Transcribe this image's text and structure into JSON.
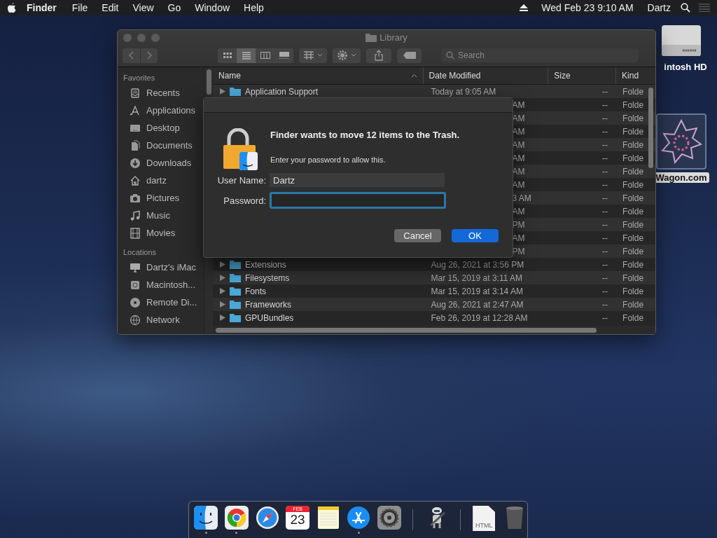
{
  "menu_bar": {
    "app_name": "Finder",
    "menus": [
      "File",
      "Edit",
      "View",
      "Go",
      "Window",
      "Help"
    ],
    "clock": "Wed Feb 23  9:10 AM",
    "user": "Dartz"
  },
  "desktop_icons": [
    {
      "kind": "drive",
      "label": "intosh HD",
      "selected": false
    },
    {
      "kind": "image",
      "label": "Wagon.com",
      "selected": true
    }
  ],
  "finder": {
    "title": "Library",
    "view_modes": [
      {
        "kind": "icons",
        "selected": false
      },
      {
        "kind": "list",
        "selected": true
      },
      {
        "kind": "columns",
        "selected": false
      },
      {
        "kind": "gallery",
        "selected": false
      }
    ],
    "search": {
      "placeholder": "Search"
    },
    "sidebar": [
      {
        "heading": "Favorites",
        "items": [
          {
            "kind": "recents",
            "label": "Recents"
          },
          {
            "kind": "applications",
            "label": "Applications"
          },
          {
            "kind": "desktop",
            "label": "Desktop"
          },
          {
            "kind": "documents",
            "label": "Documents"
          },
          {
            "kind": "downloads",
            "label": "Downloads"
          },
          {
            "kind": "home",
            "label": "dartz"
          },
          {
            "kind": "pictures",
            "label": "Pictures"
          },
          {
            "kind": "music",
            "label": "Music"
          },
          {
            "kind": "movies",
            "label": "Movies"
          }
        ]
      },
      {
        "heading": "Locations",
        "items": [
          {
            "kind": "computer",
            "label": "Dartz's iMac"
          },
          {
            "kind": "disk",
            "label": "Macintosh..."
          },
          {
            "kind": "disc",
            "label": "Remote Di..."
          },
          {
            "kind": "network",
            "label": "Network"
          }
        ]
      }
    ],
    "columns": [
      {
        "label": "Name",
        "sorted": true
      },
      {
        "label": "Date Modified",
        "sorted": false
      },
      {
        "label": "Size",
        "sorted": false
      },
      {
        "label": "Kind",
        "sorted": false
      }
    ],
    "rows": [
      {
        "name": "Application Support",
        "date": "Today at 9:05 AM",
        "size": "--",
        "kind_label": "Folde"
      },
      {
        "date": "AM",
        "size": "--",
        "kind_label": "Folde"
      },
      {
        "date": "AM",
        "size": "--",
        "kind_label": "Folde"
      },
      {
        "date": "AM",
        "size": "--",
        "kind_label": "Folde"
      },
      {
        "date": "AM",
        "size": "--",
        "kind_label": "Folde"
      },
      {
        "date": "AM",
        "size": "--",
        "kind_label": "Folde"
      },
      {
        "date": "AM",
        "size": "--",
        "kind_label": "Folde"
      },
      {
        "date": "AM",
        "size": "--",
        "kind_label": "Folde"
      },
      {
        "date": "3 AM",
        "size": "--",
        "kind_label": "Folde"
      },
      {
        "date": "AM",
        "size": "--",
        "kind_label": "Folde"
      },
      {
        "date": "PM",
        "size": "--",
        "kind_label": "Folde"
      },
      {
        "date": "AM",
        "size": "--",
        "kind_label": "Folde"
      },
      {
        "date": "PM",
        "size": "--",
        "kind_label": "Folde"
      },
      {
        "name": "Extensions",
        "date": "Aug 26, 2021 at 3:56 PM",
        "size": "--",
        "kind_label": "Folde"
      },
      {
        "name": "Filesystems",
        "date": "Mar 15, 2019 at 3:11 AM",
        "size": "--",
        "kind_label": "Folde"
      },
      {
        "name": "Fonts",
        "date": "Mar 15, 2019 at 3:14 AM",
        "size": "--",
        "kind_label": "Folde"
      },
      {
        "name": "Frameworks",
        "date": "Aug 26, 2021 at 2:47 AM",
        "size": "--",
        "kind_label": "Folde"
      },
      {
        "name": "GPUBundles",
        "date": "Feb 26, 2019 at 12:28 AM",
        "size": "--",
        "kind_label": "Folde"
      }
    ]
  },
  "dialog": {
    "title": "Finder wants to move 12 items to the Trash.",
    "message": "Enter your password to allow this.",
    "fields": [
      {
        "label": "User Name:",
        "value": "Dartz",
        "focused": false
      },
      {
        "label": "Password:",
        "focused": true
      }
    ],
    "buttons": [
      {
        "label": "Cancel",
        "default": false
      },
      {
        "label": "OK",
        "default": true
      }
    ]
  },
  "dock": [
    {
      "kind": "finder",
      "running": true
    },
    {
      "kind": "browser",
      "running": true
    },
    {
      "kind": "compass",
      "running": false
    },
    {
      "kind": "calendar",
      "month": "FEB",
      "day": "23",
      "running": false
    },
    {
      "kind": "notes",
      "running": false
    },
    {
      "kind": "appstore",
      "running": true
    },
    {
      "kind": "settings",
      "running": false
    },
    {
      "kind": "separator"
    },
    {
      "kind": "robot",
      "running": false
    },
    {
      "kind": "separator"
    },
    {
      "kind": "file",
      "file_label": "HTML",
      "running": false
    },
    {
      "kind": "trash",
      "running": false
    }
  ]
}
